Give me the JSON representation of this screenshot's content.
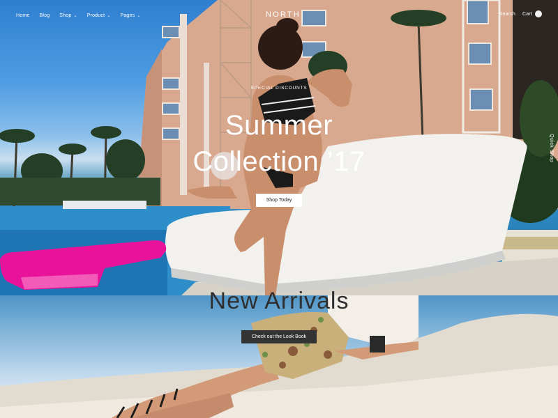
{
  "nav": {
    "items": [
      {
        "label": "Home",
        "dropdown": false
      },
      {
        "label": "Blog",
        "dropdown": false
      },
      {
        "label": "Shop",
        "dropdown": true
      },
      {
        "label": "Product",
        "dropdown": true
      },
      {
        "label": "Pages",
        "dropdown": true
      }
    ],
    "logo": "NORTH",
    "search_label": "Search",
    "cart_label": "Cart"
  },
  "side": {
    "quick_shop": "Quick Shop"
  },
  "hero": {
    "eyebrow": "Special Discounts",
    "title_line1": "Summer",
    "title_line2": "Collection ’17",
    "button": "Shop Today"
  },
  "arrivals": {
    "title": "New Arrivals",
    "button": "Check out the Look Book"
  },
  "colors": {
    "accent_float": "#e8139a",
    "button_dark": "#333333",
    "text_light": "#ffffff"
  }
}
